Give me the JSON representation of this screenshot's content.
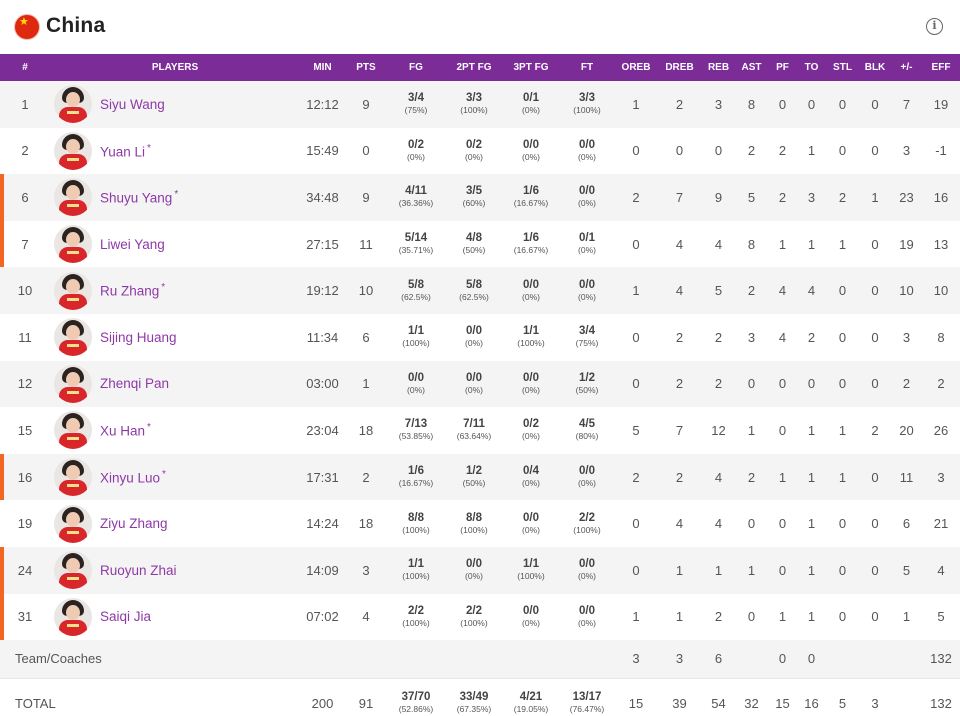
{
  "team": {
    "name": "China",
    "flag_icon": "china-flag-icon",
    "info_icon": "info-icon",
    "flag_color": "#de2910"
  },
  "colors": {
    "header_bg": "#7b2c97",
    "player_link": "#8e3aa6",
    "active_marker": "#f26522",
    "row_alt": "#f4f4f4"
  },
  "columns": [
    "#",
    "PLAYERS",
    "MIN",
    "PTS",
    "FG",
    "2PT FG",
    "3PT FG",
    "FT",
    "OREB",
    "DREB",
    "REB",
    "AST",
    "PF",
    "TO",
    "STL",
    "BLK",
    "+/-",
    "EFF"
  ],
  "players": [
    {
      "num": "1",
      "name": "Siyu Wang",
      "starter": false,
      "on_court": false,
      "min": "12:12",
      "pts": "9",
      "fg": "3/4",
      "fg_pct": "(75%)",
      "fg2": "3/3",
      "fg2_pct": "(100%)",
      "fg3": "0/1",
      "fg3_pct": "(0%)",
      "ft": "3/3",
      "ft_pct": "(100%)",
      "oreb": "1",
      "dreb": "2",
      "reb": "3",
      "ast": "8",
      "pf": "0",
      "to": "0",
      "stl": "0",
      "blk": "0",
      "pm": "7",
      "eff": "19"
    },
    {
      "num": "2",
      "name": "Yuan Li",
      "starter": true,
      "on_court": false,
      "min": "15:49",
      "pts": "0",
      "fg": "0/2",
      "fg_pct": "(0%)",
      "fg2": "0/2",
      "fg2_pct": "(0%)",
      "fg3": "0/0",
      "fg3_pct": "(0%)",
      "ft": "0/0",
      "ft_pct": "(0%)",
      "oreb": "0",
      "dreb": "0",
      "reb": "0",
      "ast": "2",
      "pf": "2",
      "to": "1",
      "stl": "0",
      "blk": "0",
      "pm": "3",
      "eff": "-1"
    },
    {
      "num": "6",
      "name": "Shuyu Yang",
      "starter": true,
      "on_court": true,
      "min": "34:48",
      "pts": "9",
      "fg": "4/11",
      "fg_pct": "(36.36%)",
      "fg2": "3/5",
      "fg2_pct": "(60%)",
      "fg3": "1/6",
      "fg3_pct": "(16.67%)",
      "ft": "0/0",
      "ft_pct": "(0%)",
      "oreb": "2",
      "dreb": "7",
      "reb": "9",
      "ast": "5",
      "pf": "2",
      "to": "3",
      "stl": "2",
      "blk": "1",
      "pm": "23",
      "eff": "16"
    },
    {
      "num": "7",
      "name": "Liwei Yang",
      "starter": false,
      "on_court": true,
      "min": "27:15",
      "pts": "11",
      "fg": "5/14",
      "fg_pct": "(35.71%)",
      "fg2": "4/8",
      "fg2_pct": "(50%)",
      "fg3": "1/6",
      "fg3_pct": "(16.67%)",
      "ft": "0/1",
      "ft_pct": "(0%)",
      "oreb": "0",
      "dreb": "4",
      "reb": "4",
      "ast": "8",
      "pf": "1",
      "to": "1",
      "stl": "1",
      "blk": "0",
      "pm": "19",
      "eff": "13"
    },
    {
      "num": "10",
      "name": "Ru Zhang",
      "starter": true,
      "on_court": false,
      "min": "19:12",
      "pts": "10",
      "fg": "5/8",
      "fg_pct": "(62.5%)",
      "fg2": "5/8",
      "fg2_pct": "(62.5%)",
      "fg3": "0/0",
      "fg3_pct": "(0%)",
      "ft": "0/0",
      "ft_pct": "(0%)",
      "oreb": "1",
      "dreb": "4",
      "reb": "5",
      "ast": "2",
      "pf": "4",
      "to": "4",
      "stl": "0",
      "blk": "0",
      "pm": "10",
      "eff": "10"
    },
    {
      "num": "11",
      "name": "Sijing Huang",
      "starter": false,
      "on_court": false,
      "min": "11:34",
      "pts": "6",
      "fg": "1/1",
      "fg_pct": "(100%)",
      "fg2": "0/0",
      "fg2_pct": "(0%)",
      "fg3": "1/1",
      "fg3_pct": "(100%)",
      "ft": "3/4",
      "ft_pct": "(75%)",
      "oreb": "0",
      "dreb": "2",
      "reb": "2",
      "ast": "3",
      "pf": "4",
      "to": "2",
      "stl": "0",
      "blk": "0",
      "pm": "3",
      "eff": "8"
    },
    {
      "num": "12",
      "name": "Zhenqi Pan",
      "starter": false,
      "on_court": false,
      "min": "03:00",
      "pts": "1",
      "fg": "0/0",
      "fg_pct": "(0%)",
      "fg2": "0/0",
      "fg2_pct": "(0%)",
      "fg3": "0/0",
      "fg3_pct": "(0%)",
      "ft": "1/2",
      "ft_pct": "(50%)",
      "oreb": "0",
      "dreb": "2",
      "reb": "2",
      "ast": "0",
      "pf": "0",
      "to": "0",
      "stl": "0",
      "blk": "0",
      "pm": "2",
      "eff": "2"
    },
    {
      "num": "15",
      "name": "Xu Han",
      "starter": true,
      "on_court": false,
      "min": "23:04",
      "pts": "18",
      "fg": "7/13",
      "fg_pct": "(53.85%)",
      "fg2": "7/11",
      "fg2_pct": "(63.64%)",
      "fg3": "0/2",
      "fg3_pct": "(0%)",
      "ft": "4/5",
      "ft_pct": "(80%)",
      "oreb": "5",
      "dreb": "7",
      "reb": "12",
      "ast": "1",
      "pf": "0",
      "to": "1",
      "stl": "1",
      "blk": "2",
      "pm": "20",
      "eff": "26"
    },
    {
      "num": "16",
      "name": "Xinyu Luo",
      "starter": true,
      "on_court": true,
      "min": "17:31",
      "pts": "2",
      "fg": "1/6",
      "fg_pct": "(16.67%)",
      "fg2": "1/2",
      "fg2_pct": "(50%)",
      "fg3": "0/4",
      "fg3_pct": "(0%)",
      "ft": "0/0",
      "ft_pct": "(0%)",
      "oreb": "2",
      "dreb": "2",
      "reb": "4",
      "ast": "2",
      "pf": "1",
      "to": "1",
      "stl": "1",
      "blk": "0",
      "pm": "11",
      "eff": "3"
    },
    {
      "num": "19",
      "name": "Ziyu Zhang",
      "starter": false,
      "on_court": false,
      "min": "14:24",
      "pts": "18",
      "fg": "8/8",
      "fg_pct": "(100%)",
      "fg2": "8/8",
      "fg2_pct": "(100%)",
      "fg3": "0/0",
      "fg3_pct": "(0%)",
      "ft": "2/2",
      "ft_pct": "(100%)",
      "oreb": "0",
      "dreb": "4",
      "reb": "4",
      "ast": "0",
      "pf": "0",
      "to": "1",
      "stl": "0",
      "blk": "0",
      "pm": "6",
      "eff": "21"
    },
    {
      "num": "24",
      "name": "Ruoyun Zhai",
      "starter": false,
      "on_court": true,
      "min": "14:09",
      "pts": "3",
      "fg": "1/1",
      "fg_pct": "(100%)",
      "fg2": "0/0",
      "fg2_pct": "(0%)",
      "fg3": "1/1",
      "fg3_pct": "(100%)",
      "ft": "0/0",
      "ft_pct": "(0%)",
      "oreb": "0",
      "dreb": "1",
      "reb": "1",
      "ast": "1",
      "pf": "0",
      "to": "1",
      "stl": "0",
      "blk": "0",
      "pm": "5",
      "eff": "4"
    },
    {
      "num": "31",
      "name": "Saiqi Jia",
      "starter": false,
      "on_court": true,
      "min": "07:02",
      "pts": "4",
      "fg": "2/2",
      "fg_pct": "(100%)",
      "fg2": "2/2",
      "fg2_pct": "(100%)",
      "fg3": "0/0",
      "fg3_pct": "(0%)",
      "ft": "0/0",
      "ft_pct": "(0%)",
      "oreb": "1",
      "dreb": "1",
      "reb": "2",
      "ast": "0",
      "pf": "1",
      "to": "1",
      "stl": "0",
      "blk": "0",
      "pm": "1",
      "eff": "5"
    }
  ],
  "team_coaches": {
    "label": "Team/Coaches",
    "oreb": "3",
    "dreb": "3",
    "reb": "6",
    "pf": "0",
    "to": "0",
    "eff": "132"
  },
  "total": {
    "label": "TOTAL",
    "min": "200",
    "pts": "91",
    "fg": "37/70",
    "fg_pct": "(52.86%)",
    "fg2": "33/49",
    "fg2_pct": "(67.35%)",
    "fg3": "4/21",
    "fg3_pct": "(19.05%)",
    "ft": "13/17",
    "ft_pct": "(76.47%)",
    "oreb": "15",
    "dreb": "39",
    "reb": "54",
    "ast": "32",
    "pf": "15",
    "to": "16",
    "stl": "5",
    "blk": "3",
    "eff": "132"
  }
}
